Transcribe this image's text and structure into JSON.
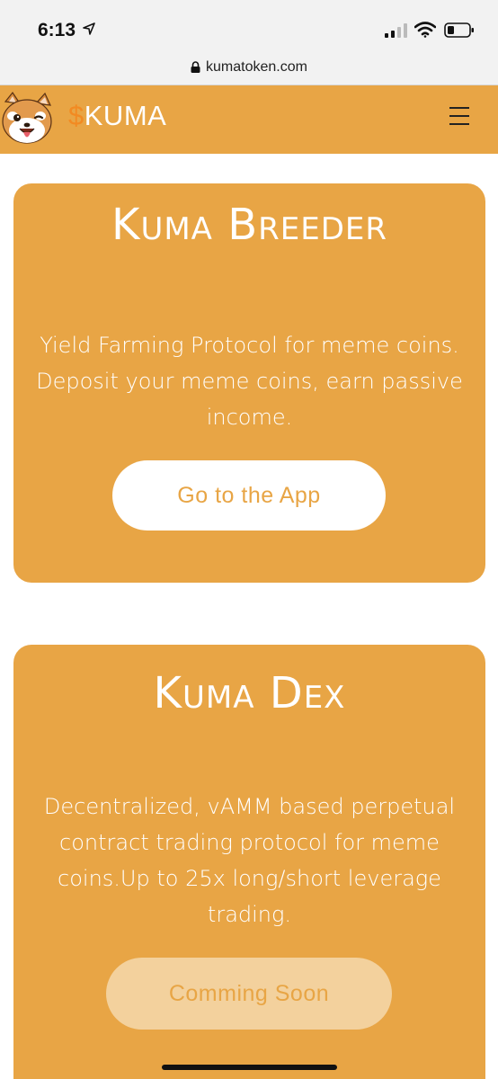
{
  "status_bar": {
    "time": "6:13"
  },
  "browser": {
    "url": "kumatoken.com"
  },
  "navbar": {
    "brand_symbol": "$",
    "brand_name": "KUMA"
  },
  "cards": [
    {
      "title": "Kuma Breeder",
      "description": "Yield Farming Protocol for meme coins. Deposit your meme coins, earn passive income.",
      "button_label": "Go to the App"
    },
    {
      "title": "Kuma Dex",
      "description": "Decentralized, vAMM based perpetual contract trading protocol for meme coins.Up to 25x long/short leverage trading.",
      "button_label": "Comming Soon"
    }
  ],
  "colors": {
    "accent": "#e8a545",
    "brand_dollar": "#f28a22",
    "disabled_button": "#f3d19d"
  }
}
